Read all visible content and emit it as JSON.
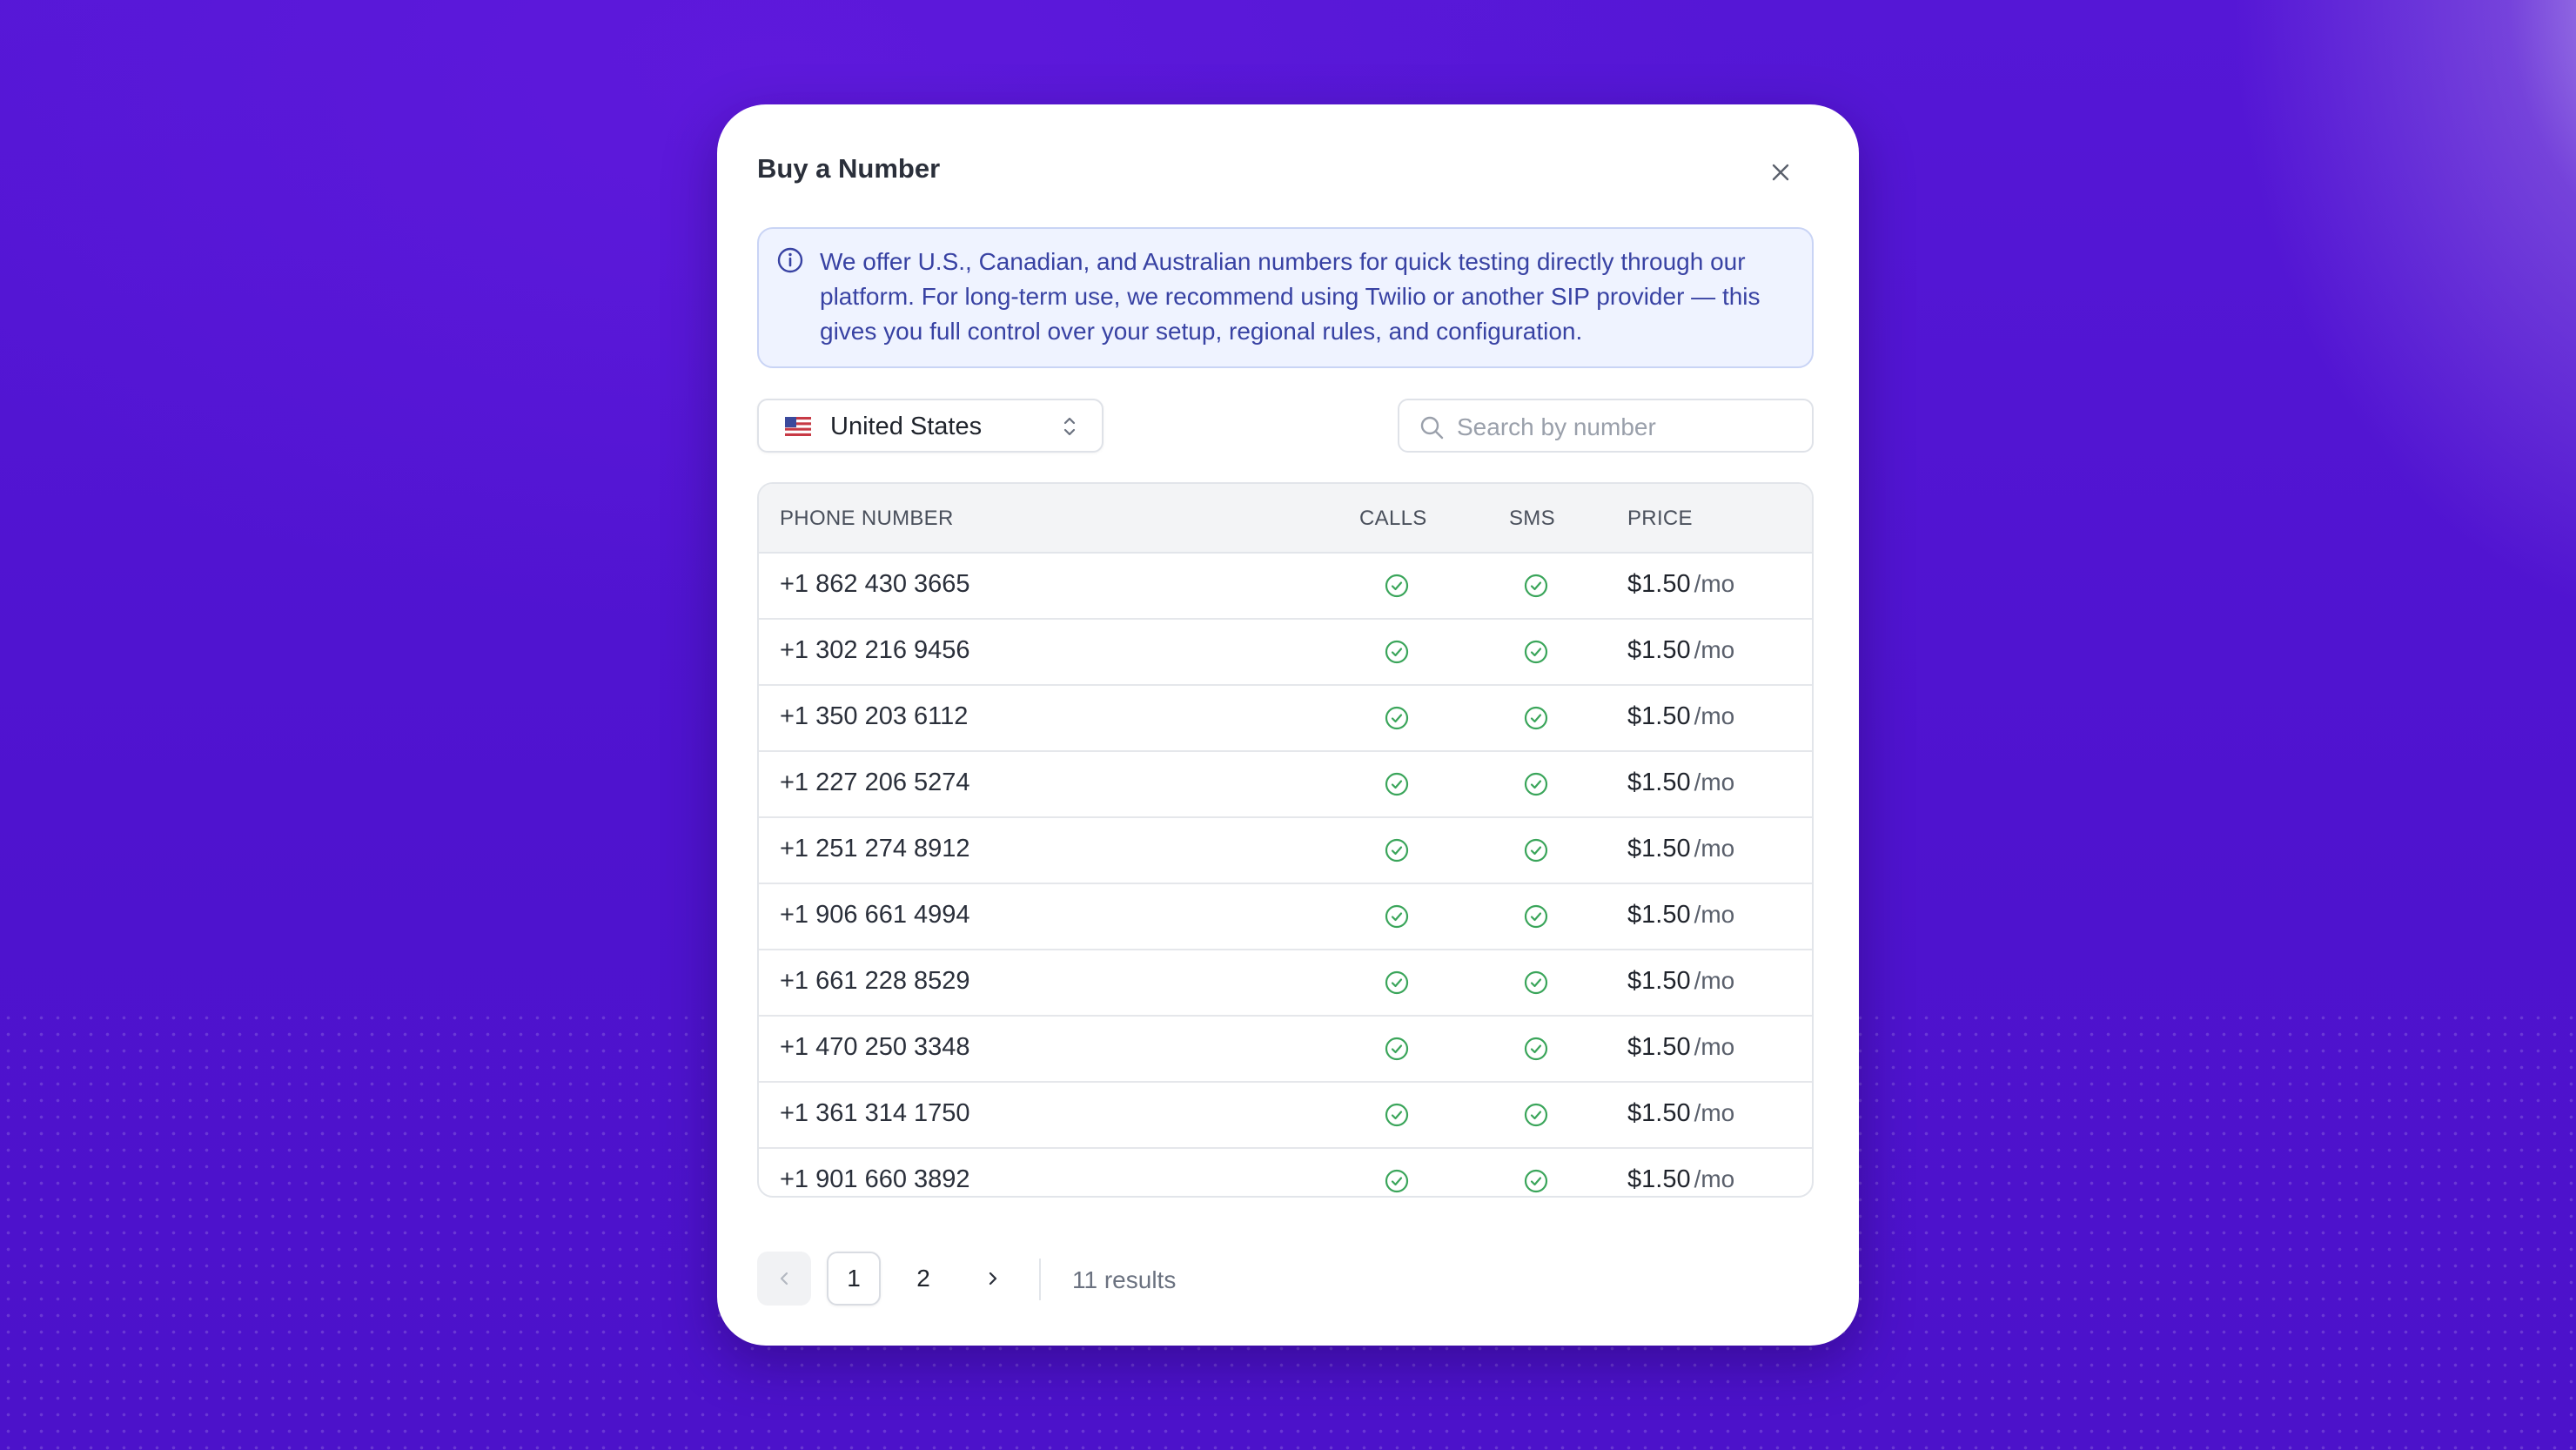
{
  "modal": {
    "title": "Buy a Number",
    "info_text": "We offer U.S., Canadian, and Australian numbers for quick testing directly through our platform. For long-term use, we recommend using Twilio or another SIP provider — this gives you full control over your setup, regional rules, and configuration."
  },
  "filters": {
    "country": "United States",
    "country_flag_icon": "us-flag-icon",
    "search_placeholder": "Search by number",
    "search_value": ""
  },
  "table": {
    "headers": [
      "PHONE NUMBER",
      "CALLS",
      "SMS",
      "PRICE"
    ],
    "rows": [
      {
        "number": "+1 862 430 3665",
        "calls": true,
        "sms": true,
        "price": "$1.50",
        "per": "/mo"
      },
      {
        "number": "+1 302 216 9456",
        "calls": true,
        "sms": true,
        "price": "$1.50",
        "per": "/mo"
      },
      {
        "number": "+1 350 203 6112",
        "calls": true,
        "sms": true,
        "price": "$1.50",
        "per": "/mo"
      },
      {
        "number": "+1 227 206 5274",
        "calls": true,
        "sms": true,
        "price": "$1.50",
        "per": "/mo"
      },
      {
        "number": "+1 251 274 8912",
        "calls": true,
        "sms": true,
        "price": "$1.50",
        "per": "/mo"
      },
      {
        "number": "+1 906 661 4994",
        "calls": true,
        "sms": true,
        "price": "$1.50",
        "per": "/mo"
      },
      {
        "number": "+1 661 228 8529",
        "calls": true,
        "sms": true,
        "price": "$1.50",
        "per": "/mo"
      },
      {
        "number": "+1 470 250 3348",
        "calls": true,
        "sms": true,
        "price": "$1.50",
        "per": "/mo"
      },
      {
        "number": "+1 361 314 1750",
        "calls": true,
        "sms": true,
        "price": "$1.50",
        "per": "/mo"
      },
      {
        "number": "+1 901 660 3892",
        "calls": true,
        "sms": true,
        "price": "$1.50",
        "per": "/mo"
      }
    ]
  },
  "pagination": {
    "pages": [
      "1",
      "2"
    ],
    "current": "1",
    "results": "11 results"
  },
  "colors": {
    "background": "#5016d2",
    "check": "#3aa55a",
    "info_text": "#3842a3"
  }
}
